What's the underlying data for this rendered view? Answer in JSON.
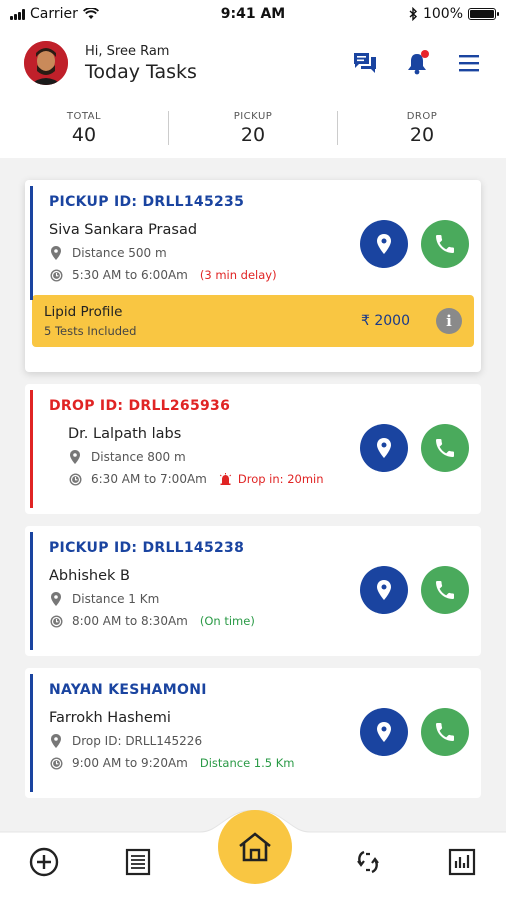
{
  "status_bar": {
    "carrier": "Carrier",
    "time": "9:41 AM",
    "battery": "100%"
  },
  "header": {
    "greeting": "Hi, Sree Ram",
    "title": "Today Tasks",
    "icons": [
      "chat-icon",
      "bell-icon",
      "menu-icon"
    ]
  },
  "stats": [
    {
      "label": "TOTAL",
      "value": "40"
    },
    {
      "label": "PICKUP",
      "value": "20"
    },
    {
      "label": "DROP",
      "value": "20"
    }
  ],
  "tasks": [
    {
      "id": "PICKUP ID: DRLL145235",
      "name": "Siva Sankara Prasad",
      "detail": "Distance 500 m",
      "time": "5:30 AM to 6:00Am",
      "note": "(3 min delay)",
      "test": {
        "name": "Lipid Profile",
        "count": "5 Tests Included",
        "price": "₹ 2000"
      }
    },
    {
      "id": "DROP ID: DRLL265936",
      "name": "Dr. Lalpath labs",
      "detail": "Distance 800 m",
      "time": "6:30 AM to 7:00Am",
      "note": "Drop in: 20min"
    },
    {
      "id": "PICKUP ID: DRLL145238",
      "name": "Abhishek B",
      "detail": "Distance 1 Km",
      "time": "8:00 AM to 8:30Am",
      "note": "(On time)"
    },
    {
      "id": "NAYAN KESHAMONI",
      "name": "Farrokh Hashemi",
      "detail": "Drop ID: DRLL145226",
      "time": "9:00 AM to 9:20Am",
      "note": "Distance 1.5 Km"
    }
  ],
  "bottom_nav": [
    "add-icon",
    "list-icon",
    "home-icon",
    "sync-icon",
    "chart-icon"
  ],
  "colors": {
    "blue": "#1a44a0",
    "red": "#e02424",
    "green": "#4aaa5c",
    "yellow": "#f9c642"
  }
}
